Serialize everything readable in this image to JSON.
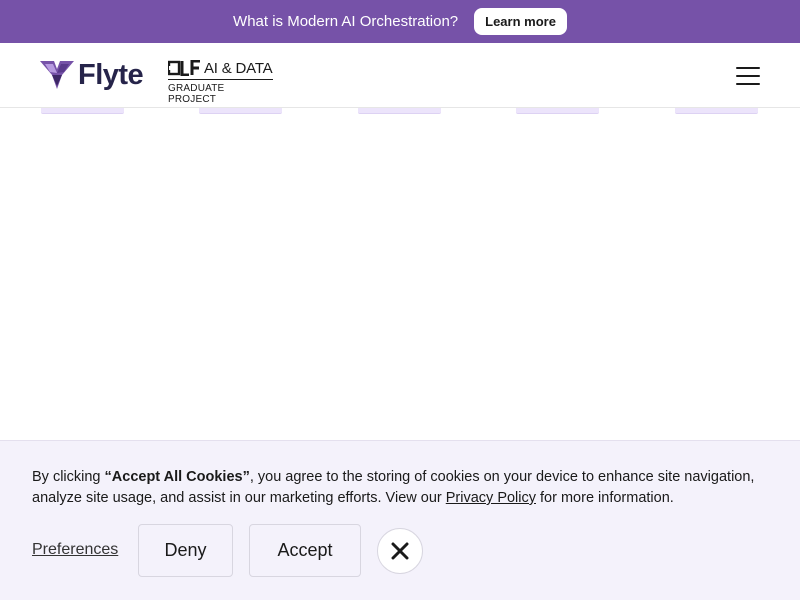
{
  "announcement": {
    "text": "What is Modern AI Orchestration?",
    "button_label": "Learn more"
  },
  "nav": {
    "brand": "Flyte",
    "partner_line1": "AI & DATA",
    "partner_line2": "GRADUATE PROJECT",
    "menu_icon": "hamburger-menu-icon"
  },
  "cookie_banner": {
    "text_prefix": "By clicking ",
    "text_bold": "“Accept All Cookies”",
    "text_middle": ", you agree to the storing of cookies on your device to enhance site navigation, analyze site usage, and assist in our marketing efforts. View our ",
    "privacy_link": "Privacy Policy",
    "text_suffix": " for more information.",
    "preferences_label": "Preferences",
    "deny_label": "Deny",
    "accept_label": "Accept",
    "close_icon": "close-icon"
  },
  "colors": {
    "announcement_bg": "#7652a8",
    "brand_purple": "#7652a8",
    "brand_dark": "#26244a",
    "banner_bg": "#f4f2fb"
  }
}
